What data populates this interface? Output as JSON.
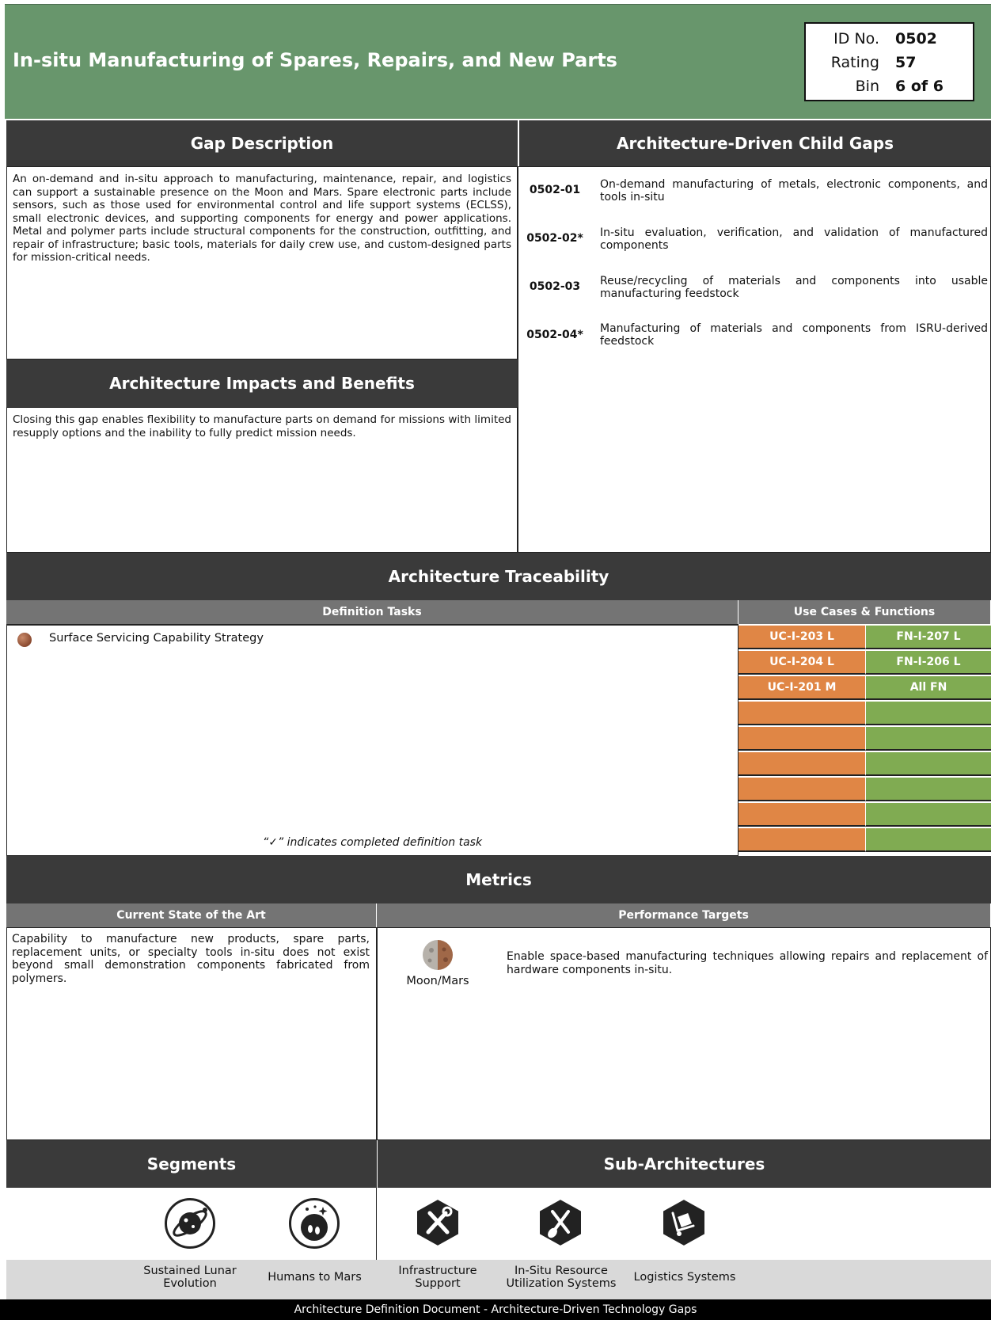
{
  "header": {
    "title": "In-situ Manufacturing of Spares, Repairs, and New Parts",
    "id_label": "ID No.",
    "id_value": "0502",
    "rating_label": "Rating",
    "rating_value": "57",
    "bin_label": "Bin",
    "bin_value": "6 of 6",
    "color": "#68966c"
  },
  "gap_description": {
    "heading": "Gap Description",
    "text": "An on-demand and in-situ approach to manufacturing, maintenance, repair, and logistics can support a sustainable presence on the Moon and Mars. Spare electronic parts include sensors, such as those used for environmental control and life support systems (ECLSS), small electronic devices, and supporting components for energy and power applications. Metal and polymer parts include structural components for the construction, outfitting, and repair of infrastructure; basic tools, materials for daily crew use, and custom-designed parts for mission-critical needs."
  },
  "impacts": {
    "heading": "Architecture Impacts and Benefits",
    "text": "Closing this gap enables flexibility to manufacture parts on demand for missions with limited resupply options and the inability to fully predict mission needs."
  },
  "child_gaps": {
    "heading": "Architecture-Driven Child Gaps",
    "items": [
      {
        "id": "0502-01",
        "text": "On-demand manufacturing of metals, electronic components, and tools in-situ"
      },
      {
        "id": "0502-02*",
        "text": "In-situ evaluation, verification, and validation of manufactured components"
      },
      {
        "id": "0502-03",
        "text": "Reuse/recycling of materials and components into usable manufacturing feedstock"
      },
      {
        "id": "0502-04*",
        "text": "Manufacturing of materials and components from ISRU-derived feedstock"
      }
    ]
  },
  "traceability": {
    "heading": "Architecture Traceability",
    "definition_tasks_heading": "Definition Tasks",
    "use_cases_heading": "Use Cases & Functions",
    "tasks": [
      {
        "label": "Surface Servicing Capability Strategy",
        "icon": "mars-dot-icon"
      }
    ],
    "note": "“✓” indicates completed definition task",
    "use_cases": [
      "UC-I-203 L",
      "UC-I-204 L",
      "UC-I-201 M",
      "",
      "",
      "",
      "",
      "",
      ""
    ],
    "functions": [
      "FN-I-207 L",
      "FN-I-206 L",
      "All FN",
      "",
      "",
      "",
      "",
      "",
      ""
    ],
    "uc_color": "#e08645",
    "fn_color": "#80ab52"
  },
  "metrics": {
    "heading": "Metrics",
    "soa_heading": "Current State of the Art",
    "targets_heading": "Performance Targets",
    "soa_text": "Capability to manufacture new products, spare parts, replacement units, or specialty tools in-situ does not exist beyond small demonstration components fabricated from polymers.",
    "target_destination": "Moon/Mars",
    "target_icon": "moon-mars-icon",
    "target_text": "Enable space-based manufacturing techniques allowing repairs and replacement of hardware components in-situ."
  },
  "segments": {
    "heading": "Segments",
    "items": [
      {
        "label": "Sustained Lunar Evolution",
        "icon": "lunar-evolution-icon"
      },
      {
        "label": "Humans to Mars",
        "icon": "humans-to-mars-icon"
      }
    ]
  },
  "sub_architectures": {
    "heading": "Sub-Architectures",
    "items": [
      {
        "label": "Infrastructure Support",
        "icon": "tools-icon"
      },
      {
        "label": "In-Situ Resource Utilization Systems",
        "icon": "shovel-icon"
      },
      {
        "label": "Logistics Systems",
        "icon": "cart-icon"
      }
    ]
  },
  "footer": {
    "text": "Architecture Definition Document - Architecture-Driven Technology Gaps"
  }
}
